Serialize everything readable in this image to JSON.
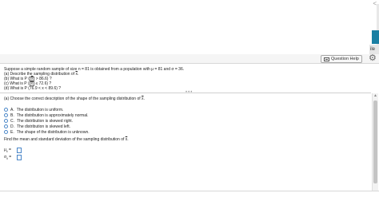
{
  "window": {
    "close_glyph": "<"
  },
  "side_panel": {
    "fragment": "ile"
  },
  "header": {
    "question_help": "Question Help",
    "help_icon": "list-icon",
    "settings_icon": "gear-icon"
  },
  "problem": {
    "intro": "Suppose a simple random sample of size n = 81 is obtained from a population with μ = 81 and σ = 36.",
    "items": [
      {
        "pre": "(a) Describe the sampling distribution of ",
        "sym": "x",
        "post": "."
      },
      {
        "pre": "(b) What is P ",
        "sym": "x",
        "post": " > 86.6) ?",
        "boxed": true
      },
      {
        "pre": "(c) What is P ",
        "sym": "x",
        "post": " ≤ 72.6) ?",
        "boxed": true
      },
      {
        "pre": "(d) What is P ",
        "sym": "x",
        "post": "",
        "extra": "(76.9 < x < 89.6) ?",
        "boxed": true
      }
    ]
  },
  "more_dots": "•••",
  "part_a": {
    "prompt_pre": "(a) Choose the correct description of the shape of the sampling distribution of ",
    "prompt_sym": "x",
    "prompt_post": "."
  },
  "options": [
    {
      "letter": "A.",
      "text": "The distribution is uniform."
    },
    {
      "letter": "B.",
      "text": "The distribution is approximately normal."
    },
    {
      "letter": "C.",
      "text": "The distribution is skewed right."
    },
    {
      "letter": "D.",
      "text": "The distribution is skewed left."
    },
    {
      "letter": "E.",
      "text": "The shape of the distribution is unknown."
    }
  ],
  "part_b": {
    "prompt_pre": "Find the mean and standard deviation of the sampling distribution of ",
    "prompt_sym": "x",
    "prompt_post": "."
  },
  "fields": [
    {
      "symbol": "μ",
      "sub": "x̄",
      "eq": "="
    },
    {
      "symbol": "σ",
      "sub": "x̄",
      "eq": "="
    }
  ],
  "colors": {
    "accent": "#1a7fa3",
    "radio_border": "#4a86c8"
  }
}
